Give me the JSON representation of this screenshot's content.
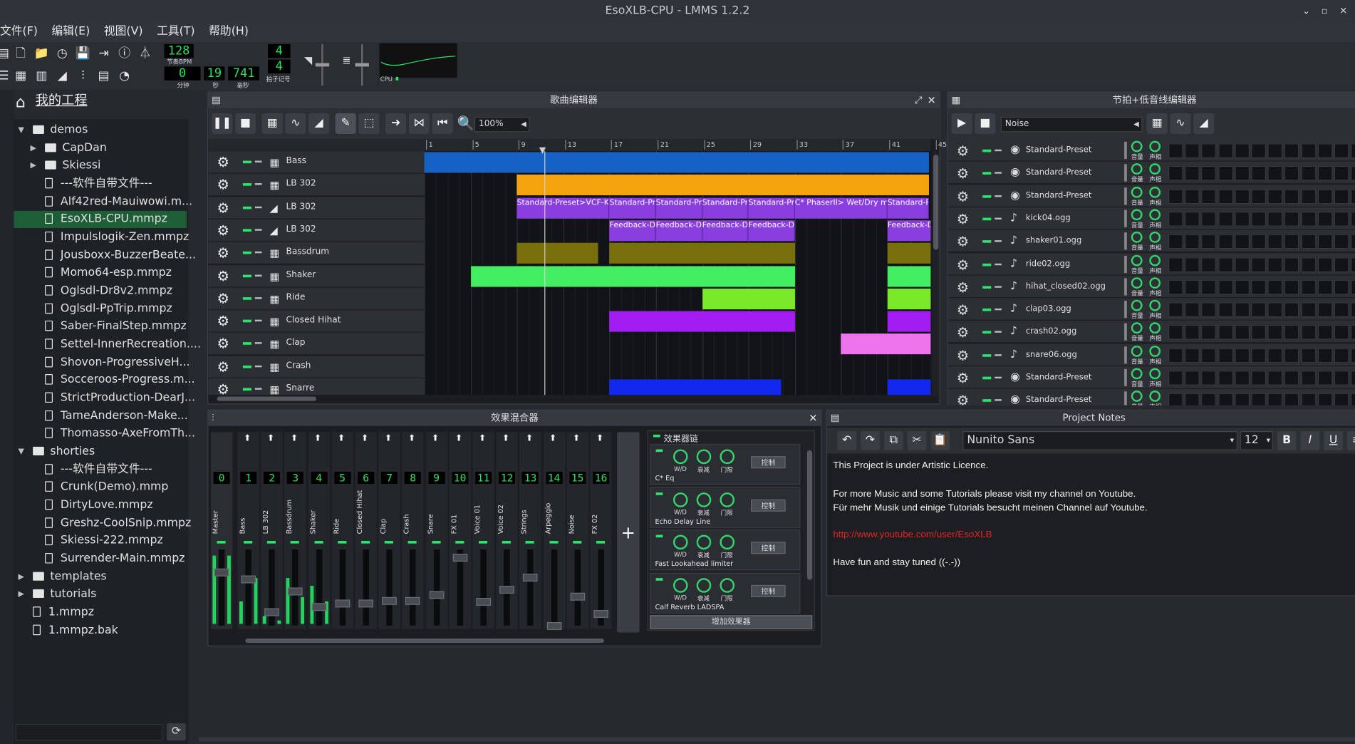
{
  "window": {
    "title": "EsoXLB-CPU - LMMS 1.2.2"
  },
  "menu": [
    "文件(F)",
    "编辑(E)",
    "视图(V)",
    "工具(T)",
    "帮助(H)"
  ],
  "toolbar": {
    "tempo": "128",
    "tempo_label": "节奏BPM",
    "time_min": "0",
    "time_sec": "19",
    "time_ms": "741",
    "min_label": "分钟",
    "sec_label": "秒",
    "ms_label": "毫秒",
    "sig_top": "4",
    "sig_bottom": "4",
    "sig_label": "拍子记号",
    "cpu_label": "CPU"
  },
  "browser": {
    "title": "我的工程",
    "items": [
      {
        "label": "demos",
        "kind": "folder",
        "level": 0,
        "open": true
      },
      {
        "label": "CapDan",
        "kind": "folder",
        "level": 1,
        "open": false
      },
      {
        "label": "Skiessi",
        "kind": "folder",
        "level": 1,
        "open": false
      },
      {
        "label": "---软件自带文件---",
        "kind": "file",
        "level": 1
      },
      {
        "label": "Alf42red-Mauiwowi.m...",
        "kind": "file",
        "level": 1
      },
      {
        "label": "EsoXLB-CPU.mmpz",
        "kind": "file",
        "level": 1,
        "selected": true
      },
      {
        "label": "Impulslogik-Zen.mmpz",
        "kind": "file",
        "level": 1
      },
      {
        "label": "Jousboxx-BuzzerBeate...",
        "kind": "file",
        "level": 1
      },
      {
        "label": "Momo64-esp.mmpz",
        "kind": "file",
        "level": 1
      },
      {
        "label": "Oglsdl-Dr8v2.mmpz",
        "kind": "file",
        "level": 1
      },
      {
        "label": "Oglsdl-PpTrip.mmpz",
        "kind": "file",
        "level": 1
      },
      {
        "label": "Saber-FinalStep.mmpz",
        "kind": "file",
        "level": 1
      },
      {
        "label": "Settel-InnerRecreation....",
        "kind": "file",
        "level": 1
      },
      {
        "label": "Shovon-ProgressiveH...",
        "kind": "file",
        "level": 1
      },
      {
        "label": "Socceroos-Progress.m...",
        "kind": "file",
        "level": 1
      },
      {
        "label": "StrictProduction-DearJ...",
        "kind": "file",
        "level": 1
      },
      {
        "label": "TameAnderson-Make...",
        "kind": "file",
        "level": 1
      },
      {
        "label": "Thomasso-AxeFromTh...",
        "kind": "file",
        "level": 1
      },
      {
        "label": "shorties",
        "kind": "folder",
        "level": 0,
        "open": true
      },
      {
        "label": "---软件自带文件---",
        "kind": "file",
        "level": 1
      },
      {
        "label": "Crunk(Demo).mmp",
        "kind": "file",
        "level": 1
      },
      {
        "label": "DirtyLove.mmpz",
        "kind": "file",
        "level": 1
      },
      {
        "label": "Greshz-CoolSnip.mmpz",
        "kind": "file",
        "level": 1
      },
      {
        "label": "Skiessi-222.mmpz",
        "kind": "file",
        "level": 1
      },
      {
        "label": "Surrender-Main.mmpz",
        "kind": "file",
        "level": 1
      },
      {
        "label": "templates",
        "kind": "folder",
        "level": 0,
        "open": false
      },
      {
        "label": "tutorials",
        "kind": "folder",
        "level": 0,
        "open": false
      },
      {
        "label": "1.mmpz",
        "kind": "file",
        "level": 0
      },
      {
        "label": "1.mmpz.bak",
        "kind": "file",
        "level": 0
      }
    ]
  },
  "song_editor": {
    "title": "歌曲编辑器",
    "zoom": "100%",
    "ruler": [
      "1",
      "5",
      "9",
      "13",
      "17",
      "21",
      "25",
      "29",
      "33",
      "37",
      "41",
      "45"
    ],
    "tracks": [
      {
        "name": "Bass",
        "icon": "bb"
      },
      {
        "name": "LB 302",
        "icon": "bb"
      },
      {
        "name": "LB 302",
        "icon": "auto"
      },
      {
        "name": "LB 302",
        "icon": "auto"
      },
      {
        "name": "Bassdrum",
        "icon": "bb"
      },
      {
        "name": "Shaker",
        "icon": "bb"
      },
      {
        "name": "Ride",
        "icon": "bb"
      },
      {
        "name": "Closed Hihat",
        "icon": "bb"
      },
      {
        "name": "Clap",
        "icon": "bb"
      },
      {
        "name": "Crash",
        "icon": "bb"
      },
      {
        "name": "Snarre",
        "icon": "bb"
      }
    ],
    "clip_texts": {
      "standard_preset": "Standard-Preset>VCF-Ke",
      "standard_pr": "Standard-Pr",
      "phaser": "C* PhaserII> Wet/Dry mix",
      "standard_pr_short": "Standard-Pr",
      "feedback": "Feedback-De",
      "feedback_delay": "Feedback-Delay"
    }
  },
  "beat_editor": {
    "title": "节拍+低音线编辑器",
    "selected": "Noise",
    "vol_label": "音量",
    "pan_label": "声相",
    "rows": [
      {
        "name": "Standard-Preset",
        "icon": "triple"
      },
      {
        "name": "Standard-Preset",
        "icon": "triple"
      },
      {
        "name": "Standard-Preset",
        "icon": "triple"
      },
      {
        "name": "kick04.ogg",
        "icon": "note"
      },
      {
        "name": "shaker01.ogg",
        "icon": "note"
      },
      {
        "name": "ride02.ogg",
        "icon": "note"
      },
      {
        "name": "hihat_closed02.ogg",
        "icon": "note"
      },
      {
        "name": "clap03.ogg",
        "icon": "note"
      },
      {
        "name": "crash02.ogg",
        "icon": "note"
      },
      {
        "name": "snare06.ogg",
        "icon": "note"
      },
      {
        "name": "Standard-Preset",
        "icon": "triple"
      },
      {
        "name": "Standard-Preset",
        "icon": "triple"
      }
    ]
  },
  "mixer": {
    "title": "效果混合器",
    "channels": [
      {
        "num": "0",
        "name": "Master"
      },
      {
        "num": "1",
        "name": "Bass"
      },
      {
        "num": "2",
        "name": "LB 302"
      },
      {
        "num": "3",
        "name": "Bassdrum"
      },
      {
        "num": "4",
        "name": "Shaker"
      },
      {
        "num": "5",
        "name": "Ride"
      },
      {
        "num": "6",
        "name": "Closed Hihat"
      },
      {
        "num": "7",
        "name": "Clap"
      },
      {
        "num": "8",
        "name": "Crash"
      },
      {
        "num": "9",
        "name": "Snare"
      },
      {
        "num": "10",
        "name": "FX 01"
      },
      {
        "num": "11",
        "name": "Voice 01"
      },
      {
        "num": "12",
        "name": "Voice 02"
      },
      {
        "num": "13",
        "name": "Strings"
      },
      {
        "num": "14",
        "name": "Arpeggio"
      },
      {
        "num": "15",
        "name": "Noise"
      },
      {
        "num": "16",
        "name": "FX 02"
      }
    ],
    "fx_chain_label": "效果器链",
    "fx": [
      {
        "name": "C* Eq"
      },
      {
        "name": "Echo Delay Line"
      },
      {
        "name": "Fast Lookahead limiter"
      },
      {
        "name": "Calf Reverb LADSPA"
      }
    ],
    "knob_labels": {
      "wd": "W/D",
      "decay": "衰减",
      "gate": "门限"
    },
    "control_label": "控制",
    "add_fx_label": "增加效果器",
    "add_channel": "+"
  },
  "notes": {
    "title": "Project Notes",
    "font": "Nunito Sans",
    "size": "12",
    "line1": "This Project is under Artistic Licence.",
    "line2": "For more Music and some Tutorials please visit my channel on Youtube.",
    "line3": "Für mehr Musik und einige Tutorials besucht meinen Channel auf Youtube.",
    "link": "http://www.youtube.com/user/EsoXLB",
    "line4": "Have fun and stay tuned ((-.-))"
  },
  "colors": {
    "accent": "#2fe26b",
    "bass": "#1561c4",
    "lb302": "#f5a30c",
    "automation": "#8a3ee0",
    "bassdrum": "#77700c",
    "shaker": "#44ee62",
    "ride": "#7ae929",
    "hihat": "#a31cf2",
    "clap": "#ee74ee",
    "snare": "#1129ec",
    "link": "#e02727"
  }
}
